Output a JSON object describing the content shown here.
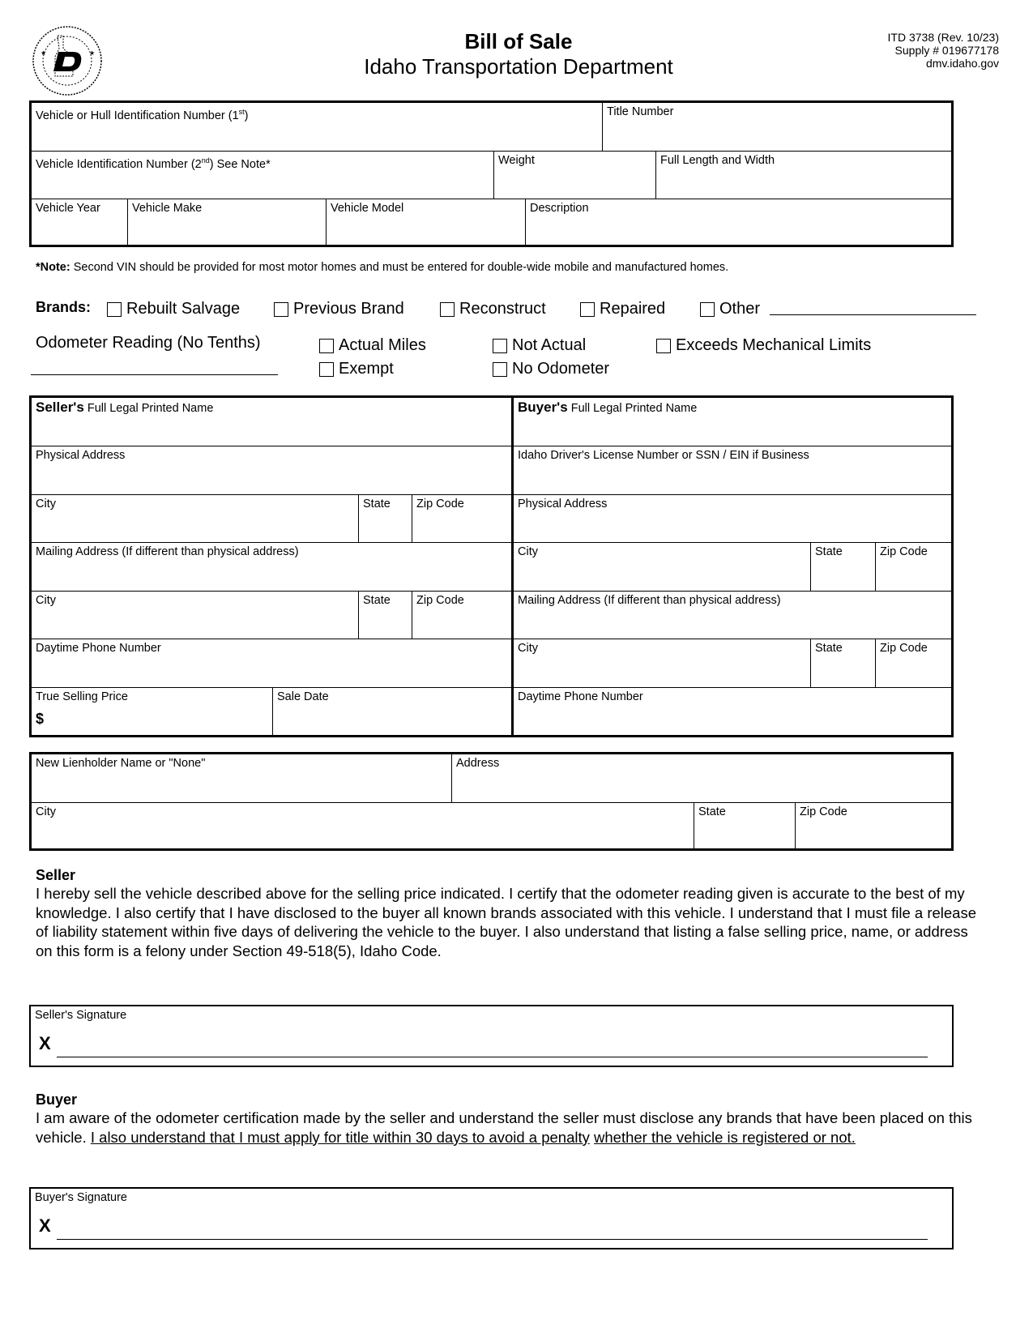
{
  "header": {
    "logo": "idaho-transportation-department-seal",
    "title": "Bill of Sale",
    "subtitle": "Idaho Transportation Department",
    "form_number": "ITD 3738 (Rev. 10/23)",
    "supply_number": "Supply # 019677178",
    "website": "dmv.idaho.gov"
  },
  "vehicle": {
    "vin1": "Vehicle or Hull Identification Number (1",
    "vin1_sup": "st",
    "vin1_close": ")",
    "title_number": "Title Number",
    "vin2": "Vehicle Identification Number (2",
    "vin2_sup": "nd",
    "vin2_close": ") See Note*",
    "weight": "Weight",
    "length_width": "Full Length and Width",
    "year": "Vehicle Year",
    "make": "Vehicle Make",
    "model": "Vehicle Model",
    "description": "Description"
  },
  "note": {
    "prefix": "*Note:",
    "text": " Second VIN should be provided for most motor homes and must be entered for double-wide mobile and manufactured homes."
  },
  "brands": {
    "label": "Brands:",
    "options": [
      "Rebuilt Salvage",
      "Previous Brand",
      "Reconstruct",
      "Repaired",
      "Other"
    ]
  },
  "odometer": {
    "label": "Odometer Reading (No Tenths)",
    "options": [
      "Actual Miles",
      "Not Actual",
      "Exceeds Mechanical Limits",
      "Exempt",
      "No Odometer"
    ]
  },
  "seller": {
    "name_bold": "Seller's",
    "name_rest": " Full Legal Printed Name",
    "physical_address": "Physical Address",
    "city": "City",
    "state": "State",
    "zip": "Zip Code",
    "mailing_address": "Mailing Address (If different than physical address)",
    "city2": "City",
    "state2": "State",
    "zip2": "Zip Code",
    "phone": "Daytime Phone Number",
    "price": "True Selling Price",
    "price_symbol": "$",
    "sale_date": "Sale Date"
  },
  "buyer": {
    "name_bold": "Buyer's",
    "name_rest": " Full Legal Printed Name",
    "license": "Idaho Driver's License Number or SSN / EIN if Business",
    "physical_address": "Physical Address",
    "city": "City",
    "state": "State",
    "zip": "Zip Code",
    "mailing_address": "Mailing Address (If different than physical address)",
    "city2": "City",
    "state2": "State",
    "zip2": "Zip Code",
    "phone": "Daytime Phone Number"
  },
  "lienholder": {
    "name": "New Lienholder Name or \"None\"",
    "address": "Address",
    "city": "City",
    "state": "State",
    "zip": "Zip Code"
  },
  "seller_cert": {
    "heading": "Seller",
    "text": "I hereby sell the vehicle described above for the selling price indicated.  I certify that the odometer reading given is accurate to the best of my knowledge.  I also certify that I have disclosed to the buyer all known brands associated with this vehicle.  I understand that I must file a release of liability statement within five days of delivering the vehicle to the buyer.  I also understand that listing a false selling price, name, or address on this form is a felony under Section 49-518(5), Idaho Code.",
    "signature_label": "Seller's Signature",
    "signature_x": "X"
  },
  "buyer_cert": {
    "heading": "Buyer",
    "text_plain": "I am aware of the odometer certification made by the seller and understand the seller must disclose any brands that have been placed on this vehicle.  ",
    "text_underlined_1": "I also understand that I must apply for title within 30 days to avoid a penalty",
    "text_space": " ",
    "text_underlined_2": "whether the vehicle is registered or not.",
    "signature_label": "Buyer's Signature",
    "signature_x": "X"
  }
}
